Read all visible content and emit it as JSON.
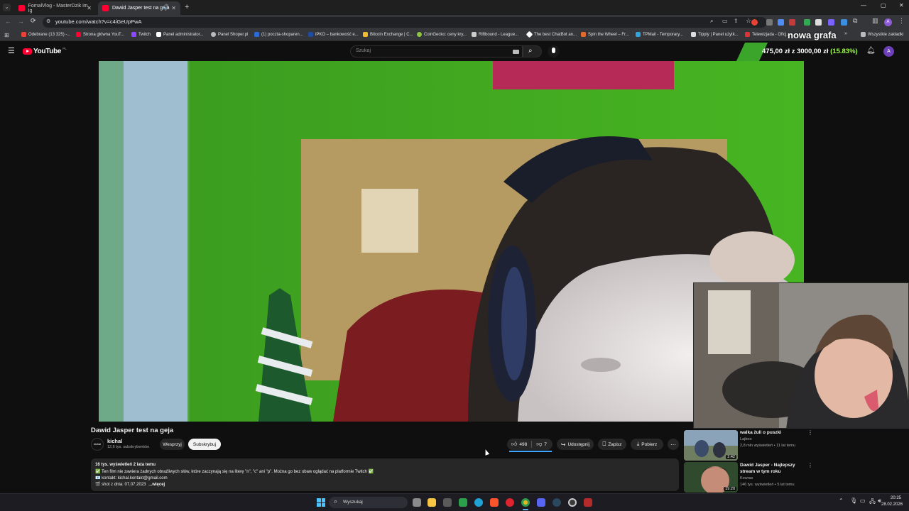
{
  "browser": {
    "tabs": [
      {
        "label": "FomalVlog - MasterDzik im. Ig",
        "active": false
      },
      {
        "label": "Dawid Jasper test na geja",
        "active": true
      }
    ],
    "url": "youtube.com/watch?v=c4iGeUpPwA",
    "bookmarks": [
      "Odebrane (13 325) -...",
      "Strona główna YouT...",
      "Twitch",
      "Panel administrator...",
      "Panel Shoper.pl",
      "(1) poczta-shoparen...",
      "iPKO – bankowość e...",
      "Bitcoin Exchange | C...",
      "CoinGecko: ceny kry...",
      "Riftbound - League...",
      "The best ChatBot an...",
      "Spin the Wheel – Fr...",
      "TPMail - Temporary...",
      "Tipply | Panel użytk...",
      "Telewizjada - Oficj...",
      "Wszystkie zakładki"
    ]
  },
  "overlay": {
    "nowa_grafa": "nowa grafa",
    "goal_amount": "475,00 zł",
    "goal_sep": "z",
    "goal_total": "3000,00 zł",
    "goal_pct": "(15.83%)",
    "goal_fraction": 0.1583
  },
  "youtube": {
    "logo": "YouTube",
    "region": "PL",
    "search_placeholder": "Szukaj",
    "avatar_letter": "A"
  },
  "video": {
    "title": "Dawid Jasper test na geja",
    "channel": "kichal",
    "channel_avatar_text": "kichal",
    "subscribers": "12,6 tys. subskrybentów",
    "support_label": "Wesprzyj",
    "subscribe_label": "Subskrybuj",
    "likes": "498",
    "dislikes": "7",
    "share_label": "Udostępnij",
    "save_label": "Zapisz",
    "download_label": "Pobierz",
    "views_line": "16 tys. wyświetleń  2 lata temu",
    "desc_lines": [
      "✅ Ten film nie zawiera żadnych obraźliwych słów, które zaczynają się na literę \"n\", \"c\" ani \"p\". Można go bez obaw oglądać na platformie Twitch ✅",
      "📧 kontakt: kichal.kontakt@gmail.com",
      "🎬 shot z dnia: 07.07.2023"
    ],
    "more_label": "...więcej"
  },
  "related": [
    {
      "title": "walka żuli o puszki",
      "channel": "Lajboo",
      "meta": "2,8 mln wyświetleń • 11 lat temu",
      "duration": "2:42"
    },
    {
      "title_1": "Dawid Jasper - Najlepszy",
      "title_2": "stream w tym roku",
      "channel": "Kowras",
      "meta": "146 tys. wyświetleń • 5 lat temu",
      "duration": "19:20"
    }
  ],
  "taskbar": {
    "search_label": "Wyszukaj",
    "time": "20:25",
    "date": "28.02.2026"
  }
}
